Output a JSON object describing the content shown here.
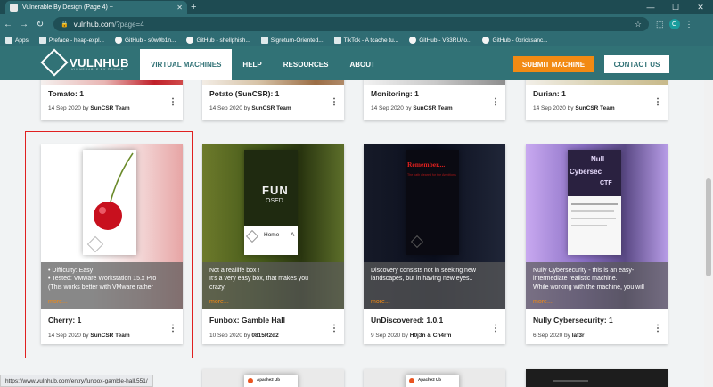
{
  "browser": {
    "tab_title": "Vulnerable By Design (Page 4) ~",
    "url_host": "vulnhub.com",
    "url_path": "/?page=4",
    "profile_initial": "C",
    "bookmarks": [
      "Apps",
      "Preface - heap-expl...",
      "GitHub - s0w0b1n...",
      "GitHub - shellphish...",
      "Sigreturn-Oriented...",
      "TikTok - A tcache tu...",
      "GitHub - V33RU/lo...",
      "GitHub - 0xricksanc..."
    ],
    "status_url": "https://www.vulnhub.com/entry/funbox-gamble-hall,551/"
  },
  "site": {
    "logo": "VULNHUB",
    "logo_tagline": "VULNERABLE BY DESIGN",
    "nav": [
      "VIRTUAL MACHINES",
      "HELP",
      "RESOURCES",
      "ABOUT"
    ],
    "submit_label": "SUBMIT MACHINE",
    "contact_label": "CONTACT US"
  },
  "cards_row1": [
    {
      "title": "Tomato: 1",
      "date": "14 Sep 2020 by",
      "author": "SunCSR Team"
    },
    {
      "title": "Potato (SunCSR): 1",
      "date": "14 Sep 2020 by",
      "author": "SunCSR Team"
    },
    {
      "title": "Monitoring: 1",
      "date": "14 Sep 2020 by",
      "author": "SunCSR Team"
    },
    {
      "title": "Durian: 1",
      "date": "14 Sep 2020 by",
      "author": "SunCSR Team"
    }
  ],
  "cards_row2": [
    {
      "title": "Cherry: 1",
      "date": "14 Sep 2020 by",
      "author": "SunCSR Team",
      "desc": [
        "• Difficulty: Easy",
        "• Tested: VMware Workstation 15.x Pro",
        "  (This works better with VMware rather"
      ],
      "more": "more..."
    },
    {
      "title": "Funbox: Gamble Hall",
      "date": "10 Sep 2020 by",
      "author": "0815R2d2",
      "desc": [
        "Not a reallife box !",
        "It's a very easy box, that makes you",
        "crazy."
      ],
      "more": "more...",
      "img_text": "FUN",
      "img_sub": "OSED",
      "img_nav": [
        "Home",
        "A"
      ]
    },
    {
      "title": "UnDiscovered: 1.0.1",
      "date": "9 Sep 2020 by",
      "author": "H0j3n & Ch4rm",
      "desc": [
        "Discovery consists not in seeking new",
        "landscapes, but in having new eyes.."
      ],
      "more": "more...",
      "img_text": "Remember....",
      "img_sub": "The path cleared for the Ambitions"
    },
    {
      "title": "Nully Cybersecurity: 1",
      "date": "6 Sep 2020 by",
      "author": "laf3r",
      "desc": [
        "Nully Cybersecurity - this is an easy-",
        "intermediate realistic machine.",
        "While working with the machine, you will"
      ],
      "more": "more...",
      "img_text": "Null",
      "img_sub": "Cybersec",
      "img_sub2": "CTF"
    }
  ],
  "cards_row3": [
    {
      "img_text": "Apache2 Ub"
    },
    {
      "img_text": "Apache2 Ub"
    },
    {
      "img_text": ""
    },
    {
      "img_text": ""
    }
  ]
}
